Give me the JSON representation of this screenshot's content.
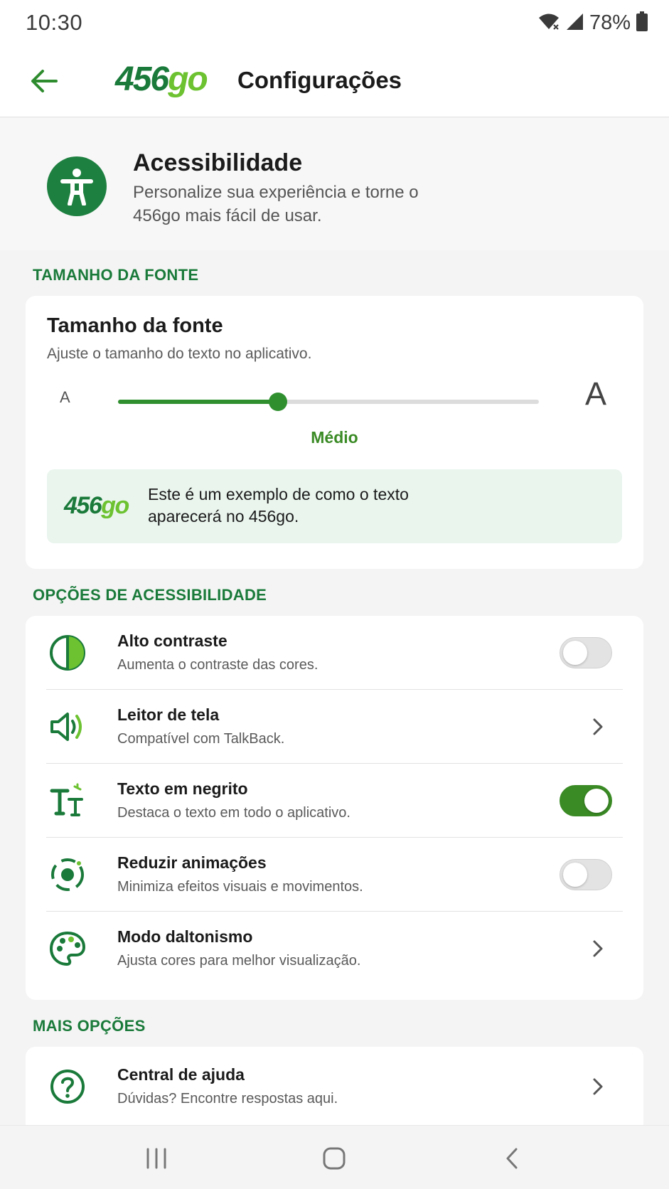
{
  "status": {
    "time": "10:30",
    "battery": "78%"
  },
  "header": {
    "logo_number": "456",
    "logo_go": "go",
    "title": "Configurações"
  },
  "hero": {
    "title": "Acessibilidade",
    "subtitle": "Personalize sua experiência e torne o 456go mais fácil de usar."
  },
  "font_section": {
    "label": "TAMANHO DA FONTE",
    "card_title": "Tamanho da fonte",
    "card_subtitle": "Ajuste o tamanho do texto no aplicativo.",
    "small_glyph": "A",
    "large_glyph": "A",
    "slider_level": 0.38,
    "slider_value_label": "Médio",
    "preview_logo_number": "456",
    "preview_logo_go": "go",
    "preview_text": "Este é um exemplo de como o texto aparecerá no 456go."
  },
  "accessibility_section": {
    "label": "OPÇÕES DE ACESSIBILIDADE",
    "items": [
      {
        "title": "Alto contraste",
        "description": "Aumenta o contraste das cores.",
        "control": "toggle",
        "on": false,
        "icon": "contrast-icon"
      },
      {
        "title": "Leitor de tela",
        "description": "Compatível com TalkBack.",
        "control": "chevron",
        "icon": "speaker-icon"
      },
      {
        "title": "Texto em negrito",
        "description": "Destaca o texto em todo o aplicativo.",
        "control": "toggle",
        "on": true,
        "icon": "bold-text-icon"
      },
      {
        "title": "Reduzir animações",
        "description": "Minimiza efeitos visuais e movimentos.",
        "control": "toggle",
        "on": false,
        "icon": "animation-icon"
      },
      {
        "title": "Modo daltonismo",
        "description": "Ajusta cores para melhor visualização.",
        "control": "chevron",
        "icon": "palette-icon"
      }
    ]
  },
  "more_section": {
    "label": "MAIS OPÇÕES",
    "items": [
      {
        "title": "Central de ajuda",
        "description": "Dúvidas? Encontre respostas aqui.",
        "control": "chevron",
        "icon": "help-icon"
      }
    ]
  },
  "colors": {
    "primary": "#1a7a3a",
    "accent": "#3a8a25",
    "logo_light": "#6cc230"
  }
}
